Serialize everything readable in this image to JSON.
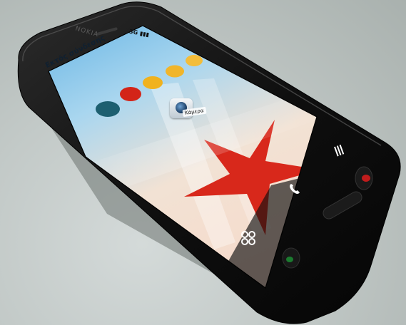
{
  "phone": {
    "brand": "NOKIA",
    "status_text": "Εκτός σύνδεσης",
    "status_icons": "3G  ▮▮▮",
    "app_label": "Κάμερα"
  },
  "icons": {
    "menu": "menu-icon",
    "call": "call-icon",
    "apps": "app-grid-icon",
    "camera": "camera-app-icon"
  },
  "colors": {
    "star": "#d8281b",
    "screen_sky": "#5fb6e6",
    "phone_body": "#121212"
  }
}
